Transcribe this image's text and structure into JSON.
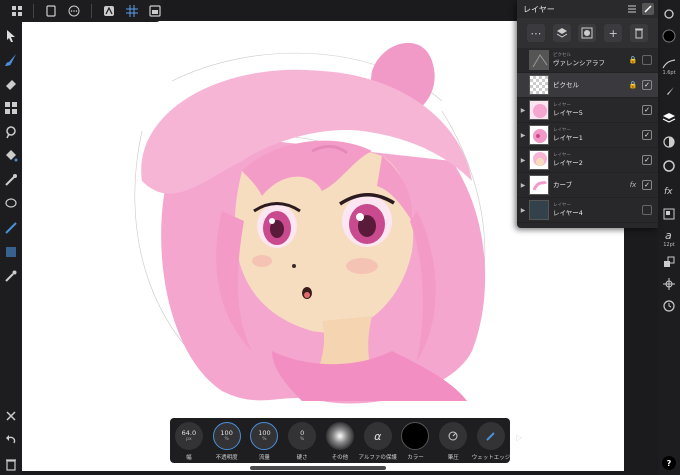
{
  "layers_panel": {
    "title": "レイヤー",
    "layers": [
      {
        "kind": "ピクセル",
        "name": "ヴァレンシアラフ",
        "locked": true,
        "visible": false,
        "selected": false
      },
      {
        "kind": "",
        "name": "ピクセル",
        "locked": true,
        "visible": true,
        "selected": true
      },
      {
        "kind": "レイヤー",
        "name": "レイヤー5",
        "visible": true
      },
      {
        "kind": "レイヤー",
        "name": "レイヤー1",
        "visible": true
      },
      {
        "kind": "レイヤー",
        "name": "レイヤー2",
        "visible": true
      },
      {
        "kind": "",
        "name": "カーブ",
        "fx": "fx",
        "visible": true
      },
      {
        "kind": "レイヤー",
        "name": "レイヤー4",
        "visible": false
      }
    ]
  },
  "context_toolbar": {
    "width": {
      "value": "64.0",
      "unit": "px",
      "label": "幅"
    },
    "opacity": {
      "value": "100",
      "unit": "%",
      "label": "不透明度"
    },
    "flow": {
      "value": "100",
      "unit": "%",
      "label": "流量"
    },
    "hardness": {
      "value": "0",
      "unit": "%",
      "label": "硬さ"
    },
    "other_label": "その他",
    "alpha_protect_label": "アルファの保護",
    "color_label": "カラー",
    "pressure_label": "筆圧",
    "wet_edge_label": "ウェットエッジ",
    "color": "#000000"
  },
  "right_toolbar": {
    "brush_size": "1.6pt",
    "text_size": "12pt"
  },
  "colors": {
    "accent": "#4a8fd8",
    "hair": "#f4a6cf",
    "skin": "#f7ddc0"
  }
}
